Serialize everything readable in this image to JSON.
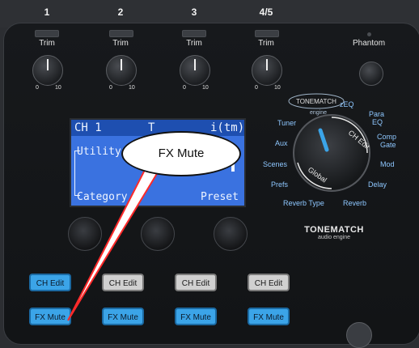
{
  "channels": [
    {
      "number": "1",
      "trim_label": "Trim",
      "scale_min": "0",
      "scale_max": "10",
      "edit_label": "CH Edit",
      "edit_active": true,
      "mute_label": "FX Mute"
    },
    {
      "number": "2",
      "trim_label": "Trim",
      "scale_min": "0",
      "scale_max": "10",
      "edit_label": "CH Edit",
      "edit_active": false,
      "mute_label": "FX Mute"
    },
    {
      "number": "3",
      "trim_label": "Trim",
      "scale_min": "0",
      "scale_max": "10",
      "edit_label": "CH Edit",
      "edit_active": false,
      "mute_label": "FX Mute"
    },
    {
      "number": "4/5",
      "trim_label": "Trim",
      "scale_min": "0",
      "scale_max": "10",
      "edit_label": "CH Edit",
      "edit_active": false,
      "mute_label": "FX Mute"
    }
  ],
  "phantom": {
    "label": "Phantom"
  },
  "lcd": {
    "header_left": "CH 1",
    "header_right": "T",
    "header_right_tail": "i(tm)",
    "line_utility": "Utility",
    "line_category": "Category",
    "line_preset": "Preset"
  },
  "rotary": {
    "labels": {
      "tonematch_engine": "engine",
      "zeq": "zEQ",
      "para_eq_1": "Para",
      "para_eq_2": "EQ",
      "tuner": "Tuner",
      "comp_gate_1": "Comp",
      "comp_gate_2": "Gate",
      "aux": "Aux",
      "mod": "Mod",
      "scenes": "Scenes",
      "delay": "Delay",
      "prefs": "Prefs",
      "reverb_type": "Reverb Type",
      "reverb": "Reverb",
      "ch_edit": "CH Edit",
      "global": "Global"
    }
  },
  "brand": {
    "logo_text": "TONEMATCH",
    "sub_text": "audio engine"
  },
  "callout": {
    "text": "FX Mute"
  },
  "colors": {
    "accent_blue": "#3ba4e8",
    "lcd_blue": "#3a72e0",
    "panel": "#16181b",
    "label_blue": "#8ec7ff"
  }
}
